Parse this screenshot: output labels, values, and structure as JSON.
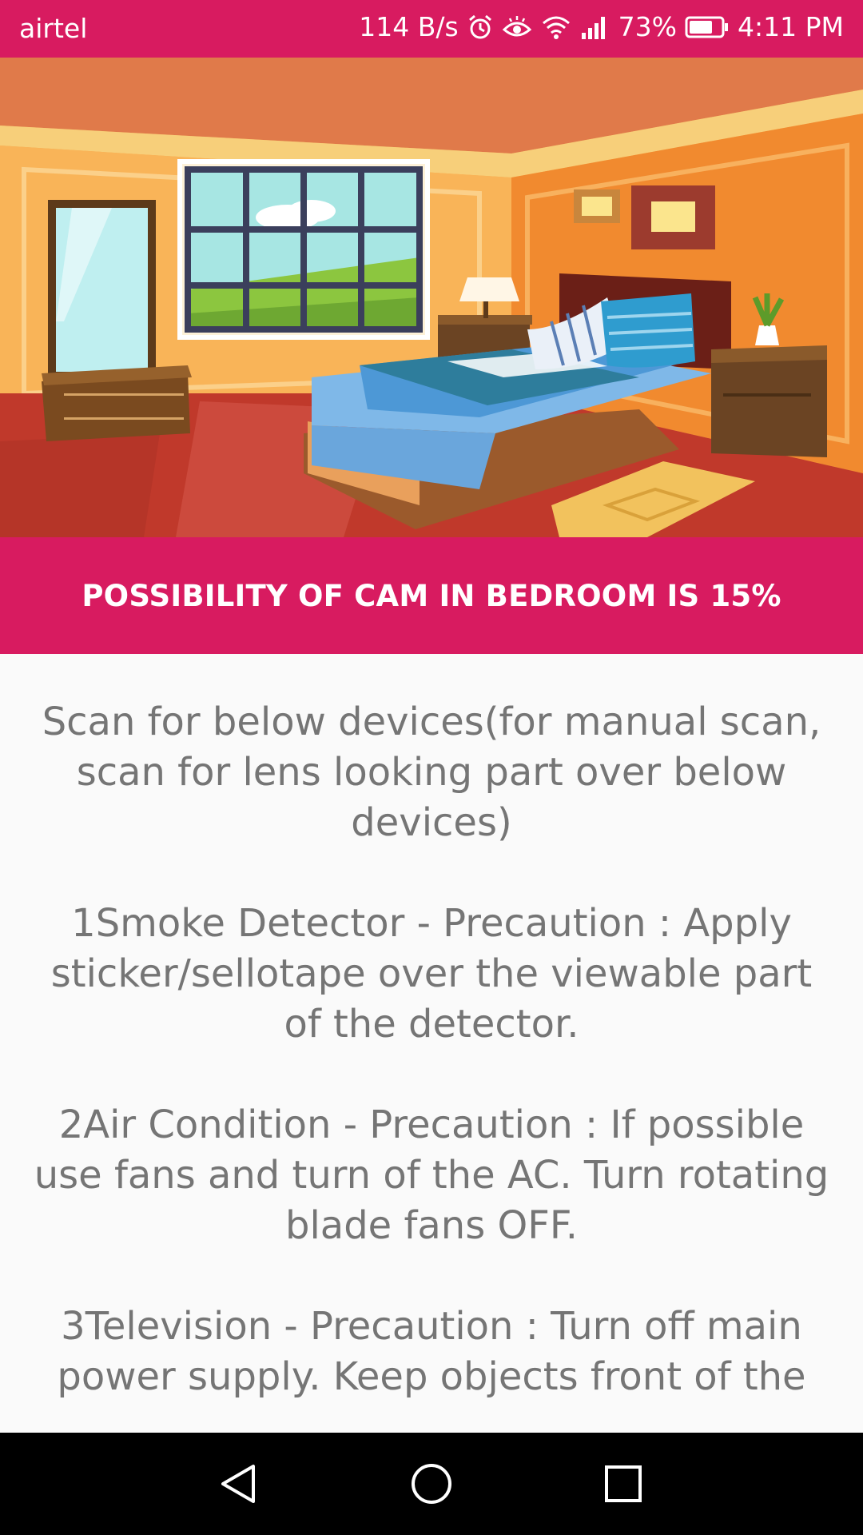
{
  "status_bar": {
    "carrier": "airtel",
    "speed": "114 B/s",
    "battery": "73%",
    "battery_level": 0.73,
    "time": "4:11 PM",
    "icons": [
      "alarm-icon",
      "eye-comfort-icon",
      "wifi-icon",
      "signal-icon",
      "battery-icon"
    ]
  },
  "hero": {
    "image": "bedroom-illustration"
  },
  "banner": {
    "text": "POSSIBILITY OF CAM IN BEDROOM IS 15%"
  },
  "content": {
    "intro": "Scan for below devices(for manual scan, scan for lens looking part over below devices)",
    "items": [
      "1Smoke Detector - Precaution : Apply sticker/sellotape over the viewable part of the detector.",
      "2Air Condition - Precaution : If possible use fans and turn of the AC. Turn rotating blade fans OFF.",
      "3Television - Precaution : Turn off main power supply. Keep objects front of the"
    ]
  },
  "nav_bar": {
    "buttons": [
      "back-icon",
      "home-icon",
      "recents-icon"
    ]
  },
  "colors": {
    "accent": "#d81b60",
    "text": "#757575",
    "background": "#fafafa"
  }
}
